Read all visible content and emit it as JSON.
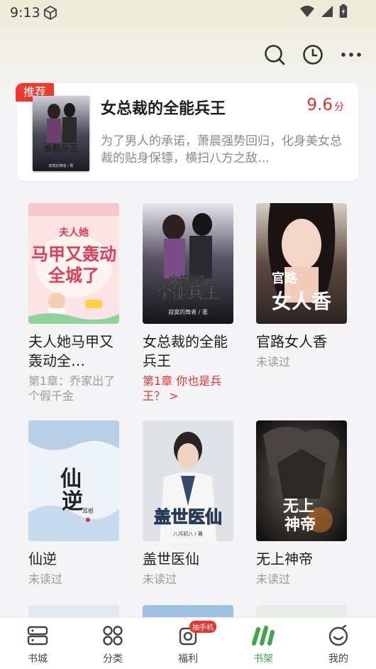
{
  "status": {
    "time": "9:13"
  },
  "recommend": {
    "badge": "推荐",
    "title": "女总裁的全能兵王",
    "score": "9.6",
    "score_unit": "分",
    "description": "为了男人的承诺，萧晨强势回归，化身美女总裁的贴身保镖，横扫八方之敌…"
  },
  "books": [
    {
      "title": "夫人她马甲又轰动全…",
      "progress": "第1章：乔家出了个假千金",
      "cover_text": "夫人她马甲又轰动全城了"
    },
    {
      "title": "女总裁的全能兵王",
      "progress": "第1章 你也是兵王？ >",
      "cover_text": "女总裁的全能兵王",
      "cover_author": "寂寞的舞者 / 著"
    },
    {
      "title": "官路女人香",
      "progress": "未读过",
      "cover_text": "官路女人香"
    },
    {
      "title": "仙逆",
      "progress": "未读过",
      "cover_text": "仙逆",
      "cover_author": "耳根"
    },
    {
      "title": "盖世医仙",
      "progress": "未读过",
      "cover_text": "盖世医仙",
      "cover_author": "八月初八 / 著"
    },
    {
      "title": "无上神帝",
      "progress": "未读过",
      "cover_text": "无上神帝"
    }
  ],
  "tabs": [
    {
      "label": "书城",
      "icon": "bookstore-icon"
    },
    {
      "label": "分类",
      "icon": "category-icon"
    },
    {
      "label": "福利",
      "icon": "gift-icon",
      "badge": "抽手机"
    },
    {
      "label": "书架",
      "icon": "bookshelf-icon",
      "active": true
    },
    {
      "label": "我的",
      "icon": "profile-icon"
    }
  ],
  "colors": {
    "accent": "#3fa649",
    "red": "#e8342c"
  }
}
